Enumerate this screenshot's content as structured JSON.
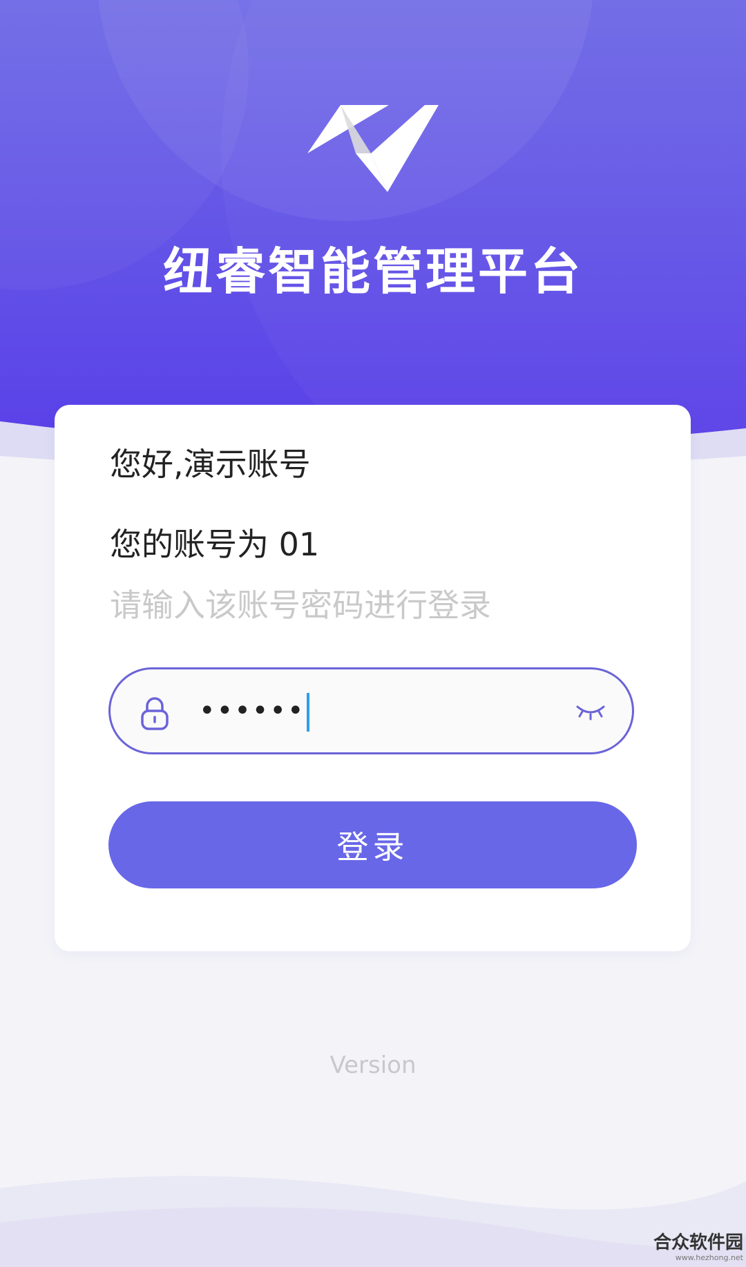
{
  "header": {
    "app_title": "纽睿智能管理平台"
  },
  "login_card": {
    "greeting": "您好,演示账号",
    "account_line": "您的账号为 01",
    "hint": "请输入该账号密码进行登录",
    "password_value": "••••••",
    "login_label": "登录"
  },
  "footer": {
    "version": "Version"
  },
  "watermark": {
    "name": "合众软件园",
    "site": "www.hezhong.net"
  },
  "colors": {
    "header_gradient_top": "#6e68e6",
    "header_gradient_bottom": "#5a44e8",
    "accent": "#6867e8",
    "field_border": "#6a63d8",
    "caret": "#2f9cf0",
    "background": "#f3f3f8"
  },
  "icons": {
    "logo": "logo-mark",
    "password_field": "lock-icon",
    "toggle_visibility": "eye-closed-icon"
  }
}
